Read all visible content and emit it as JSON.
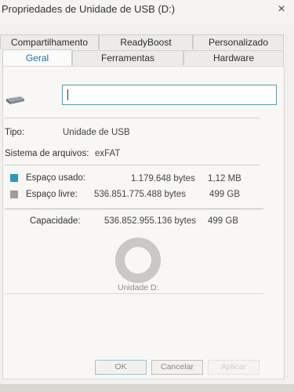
{
  "window": {
    "title": "Propriedades de Unidade de USB (D:)",
    "close_glyph": "×"
  },
  "tabs": {
    "row1": [
      {
        "label": "Compartilhamento"
      },
      {
        "label": "ReadyBoost"
      },
      {
        "label": "Personalizado"
      }
    ],
    "row2": [
      {
        "label": "Geral",
        "active": true
      },
      {
        "label": "Ferramentas"
      },
      {
        "label": "Hardware"
      }
    ]
  },
  "general": {
    "drive_icon": "usb-drive-icon",
    "name_value": "",
    "type_label": "Tipo:",
    "type_value": "Unidade de USB",
    "fs_label": "Sistema de arquivos:",
    "fs_value": "exFAT",
    "used": {
      "label": "Espaço usado:",
      "bytes": "1.179.648 bytes",
      "size": "1,12 MB",
      "color": "#2f93c4"
    },
    "free": {
      "label": "Espaço livre:",
      "bytes": "536.851.775.488 bytes",
      "size": "499 GB",
      "color": "#9d9d9d"
    },
    "capacity": {
      "label": "Capacidade:",
      "bytes": "536.852.955.136 bytes",
      "size": "499 GB"
    },
    "drive_caption": "Unidade D:",
    "usage_fraction_used": 2.2e-06
  },
  "buttons": {
    "ok": "OK",
    "cancel": "Cancelar",
    "apply": "Aplicar"
  }
}
